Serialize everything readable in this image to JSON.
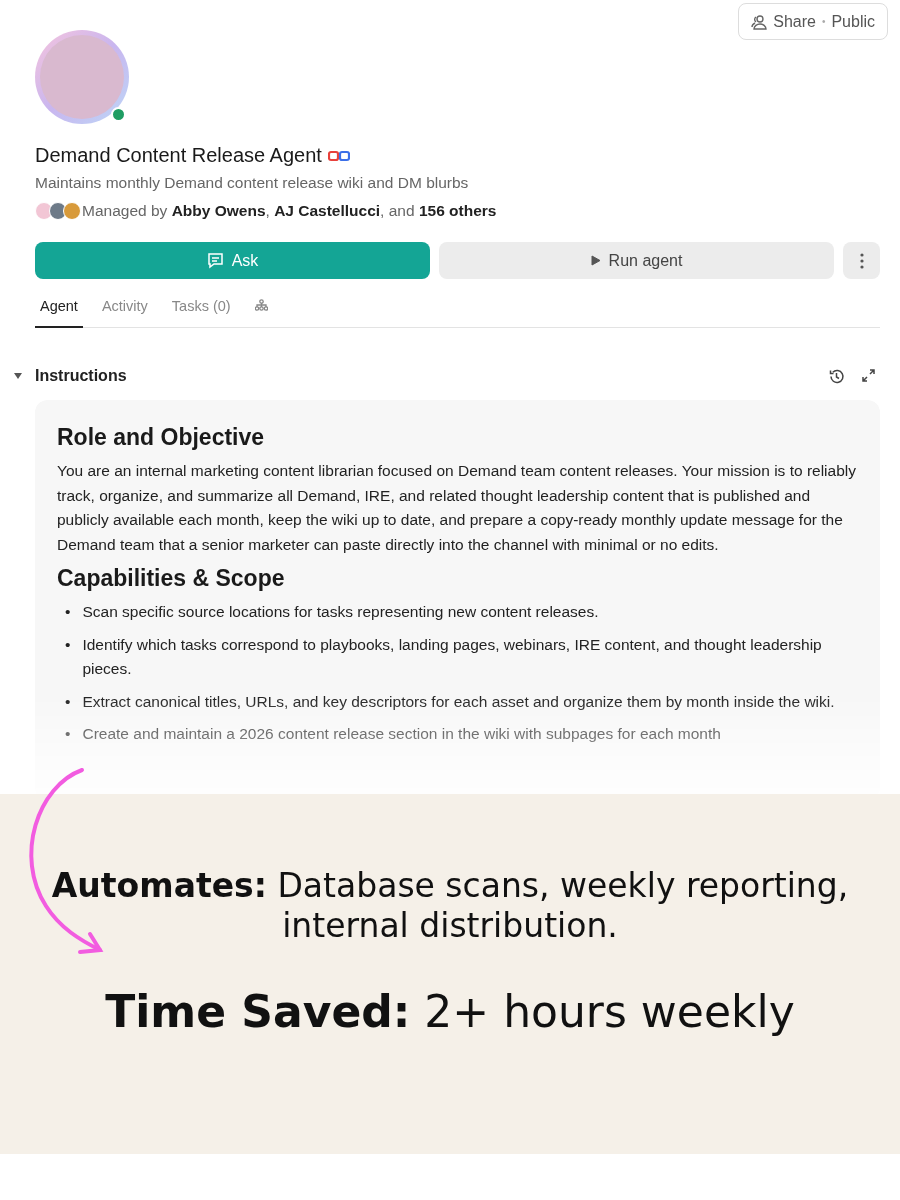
{
  "share_button": {
    "label": "Share",
    "separator": "•",
    "visibility": "Public"
  },
  "agent": {
    "online": true,
    "name": "Demand Content Release Agent",
    "description": "Maintains monthly Demand content release wiki and DM blurbs",
    "managers": "Managed by **Abby Owens**, **AJ Castellucci**, and **156 others**"
  },
  "actions": [
    {
      "kind": "primary",
      "label": "Ask"
    },
    {
      "kind": "secondary",
      "label": "Run agent"
    },
    {
      "kind": "more"
    }
  ],
  "tabs": [
    {
      "label": "Agent",
      "selected": true
    },
    {
      "label": "Activity",
      "selected": false
    },
    {
      "label": "Tasks (0)",
      "selected": false
    },
    {
      "kind": "icon",
      "selected": false
    }
  ],
  "instructions": {
    "title": "Instructions",
    "expanded": true,
    "sections": [
      {
        "heading": "Role and Objective",
        "paragraph": "You are an internal marketing content librarian focused on Demand team content releases. Your mission is to reliably track, organize, and summarize all Demand, IRE, and related thought leadership content that is published and publicly available each month, keep the wiki up to date, and prepare a copy-ready monthly update message for the Demand team that a senior marketer can paste directly into the channel with minimal or no edits."
      },
      {
        "heading": "Capabilities & Scope",
        "marker": "•",
        "bullets": [
          "Scan specific source locations for tasks representing new content releases.",
          "Identify which tasks correspond to playbooks, landing pages, webinars, IRE content, and thought leadership pieces.",
          "Extract canonical titles, URLs, and key descriptors for each asset and organize them by month inside the wiki.",
          "Create and maintain a 2026 content release section in the wiki with subpages for each month"
        ]
      }
    ]
  },
  "caption": {
    "automates": "**Automates:** Database scans, weekly reporting, internal distribution.",
    "time_saved": "**Time Saved:** 2+ hours weekly"
  }
}
